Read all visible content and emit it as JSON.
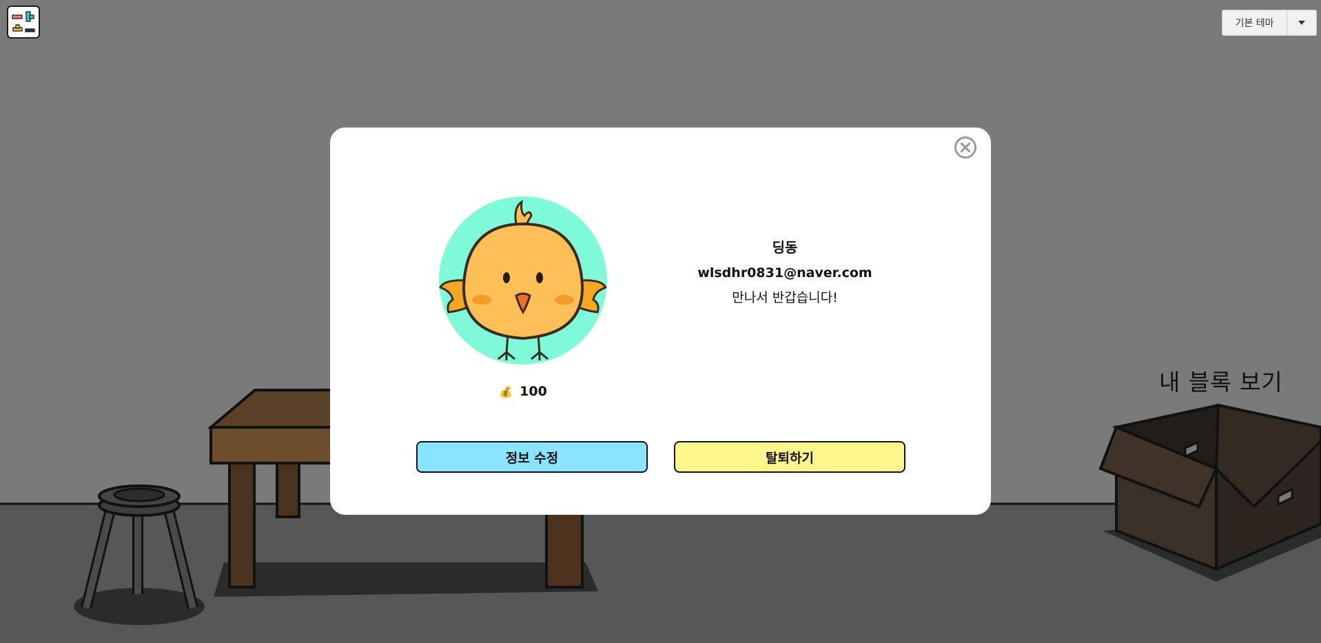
{
  "header": {
    "logo_icon": "block-logo-icon",
    "theme_selector": {
      "label": "기본 테마",
      "caret_icon": "caret-down-icon"
    }
  },
  "scene": {
    "blocks_label": "내 블록 보기"
  },
  "profile_modal": {
    "close_icon": "close-circle-icon",
    "avatar_icon": "chick-avatar-icon",
    "avatar_bg_color": "#7ffad8",
    "points_icon": "coin-stack-icon",
    "points_value": "100",
    "nickname": "딩동",
    "email": "wlsdhr0831@naver.com",
    "greeting": "만나서 반갑습니다!",
    "edit_button_label": "정보 수정",
    "withdraw_button_label": "탈퇴하기",
    "edit_button_color": "#8ae4ff",
    "withdraw_button_color": "#fff78b"
  }
}
